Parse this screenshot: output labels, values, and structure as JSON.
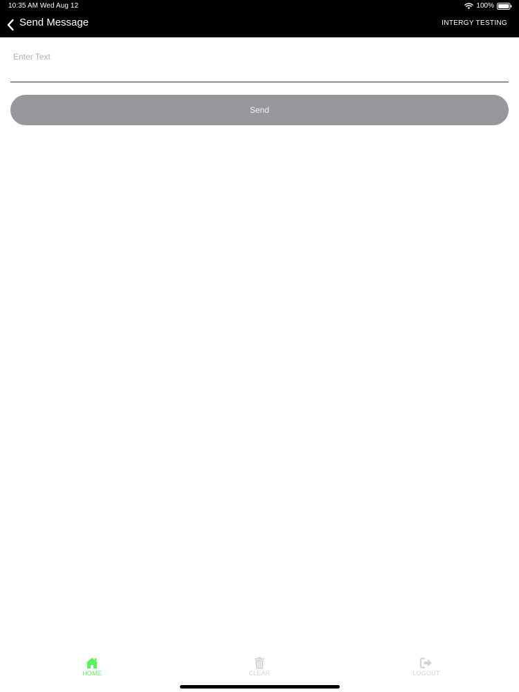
{
  "status_bar": {
    "time_date": "10:35 AM   Wed Aug 12",
    "battery": "100%",
    "wifi_icon": "wifi-icon",
    "battery_icon": "battery-icon"
  },
  "nav": {
    "back_icon": "chevron-left-icon",
    "title": "Send Message",
    "right_label": "INTERGY TESTING"
  },
  "form": {
    "input_value": "",
    "input_placeholder": "Enter Text",
    "send_label": "Send"
  },
  "tabs": [
    {
      "label": "HOME",
      "icon": "home-icon",
      "active": true
    },
    {
      "label": "CLEAR",
      "icon": "trash-icon",
      "active": false
    },
    {
      "label": "LOGOUT",
      "icon": "logout-icon",
      "active": false
    }
  ],
  "colors": {
    "header_bg": "#000000",
    "button_bg": "#98979b",
    "active_tab": "#5ef05e",
    "inactive_tab": "#d4d4d4"
  }
}
